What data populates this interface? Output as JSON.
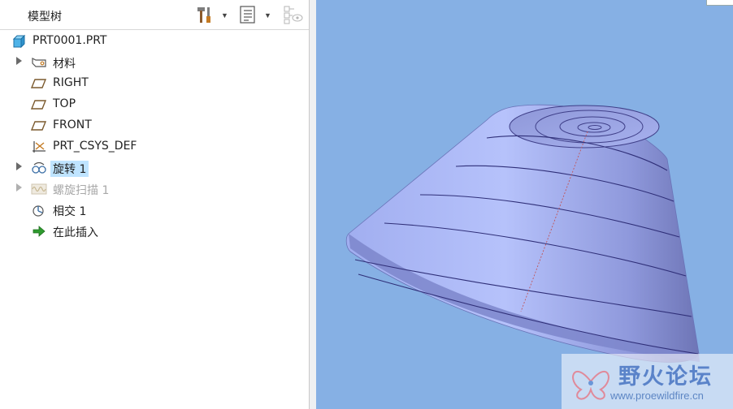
{
  "panel": {
    "title": "模型树",
    "toolbar": {
      "settings_icon": "hammer-tools-icon",
      "show_icon": "list-document-icon",
      "filter_icon": "tree-filter-icon"
    }
  },
  "tree": {
    "root": {
      "label": "PRT0001.PRT",
      "icon": "part-cube-icon"
    },
    "items": [
      {
        "label": "材料",
        "icon": "material-tag-icon",
        "expandable": true
      },
      {
        "label": "RIGHT",
        "icon": "datum-plane-icon",
        "expandable": false
      },
      {
        "label": "TOP",
        "icon": "datum-plane-icon",
        "expandable": false
      },
      {
        "label": "FRONT",
        "icon": "datum-plane-icon",
        "expandable": false
      },
      {
        "label": "PRT_CSYS_DEF",
        "icon": "csys-icon",
        "expandable": false
      },
      {
        "label": "旋转 1",
        "icon": "revolve-icon",
        "expandable": true,
        "selected": true
      },
      {
        "label": "螺旋扫描 1",
        "icon": "helical-sweep-icon",
        "expandable": true,
        "suppressed": true
      },
      {
        "label": "相交 1",
        "icon": "intersect-icon",
        "expandable": false
      },
      {
        "label": "在此插入",
        "icon": "insert-here-arrow-icon",
        "expandable": false
      }
    ]
  },
  "viewport": {
    "background": "#86b0e4",
    "model_color": "#a7b5ee"
  },
  "watermark": {
    "text": "野火论坛",
    "url": "www.proewildfire.cn"
  }
}
